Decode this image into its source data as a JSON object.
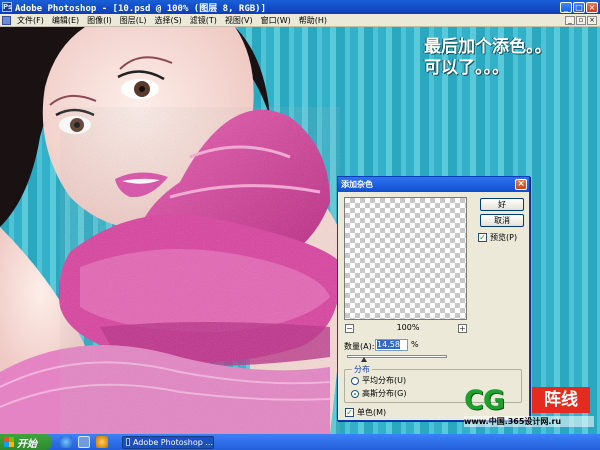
{
  "window": {
    "title": "Adobe Photoshop - [10.psd @ 100% (图层 8, RGB)]",
    "app_icon": "photoshop-icon",
    "controls": [
      "minimize-icon",
      "maximize-icon",
      "close-icon"
    ]
  },
  "menu": {
    "items": [
      "文件(F)",
      "编辑(E)",
      "图像(I)",
      "图层(L)",
      "选择(S)",
      "滤镜(T)",
      "视图(V)",
      "窗口(W)",
      "帮助(H)"
    ]
  },
  "caption": {
    "line1": "最后加个添色。。",
    "line2": "可以了。。。"
  },
  "dialog": {
    "title": "添加杂色",
    "ok_label": "好",
    "cancel_label": "取消",
    "preview_label": "预览(P)",
    "preview_checked": true,
    "zoom_minus": "−",
    "zoom_plus": "+",
    "zoom_level": "100%",
    "amount_label": "数量(A):",
    "amount_value": "14.58",
    "amount_unit": "%",
    "distribution_legend": "分布",
    "uniform_label": "平均分布(U)",
    "gaussian_label": "高斯分布(G)",
    "distribution_selected": "gaussian",
    "monochrome_label": "单色(M)",
    "monochrome_checked": true,
    "check_glyph": "✓"
  },
  "watermark": {
    "cg": "CG",
    "zhenxian": "阵线",
    "url": "www.中国.365设计网.ru"
  },
  "taskbar": {
    "start_label": "开始",
    "quick_launch": [
      "internet-explorer-icon",
      "show-desktop-icon",
      "media-player-icon"
    ],
    "task_label": "Adobe Photoshop ..."
  },
  "colors": {
    "background_teal": "#3ab3c8",
    "fabric_pink": "#d9409e",
    "titlebar_blue": "#0b3fb4",
    "taskbar_blue": "#245edb"
  }
}
